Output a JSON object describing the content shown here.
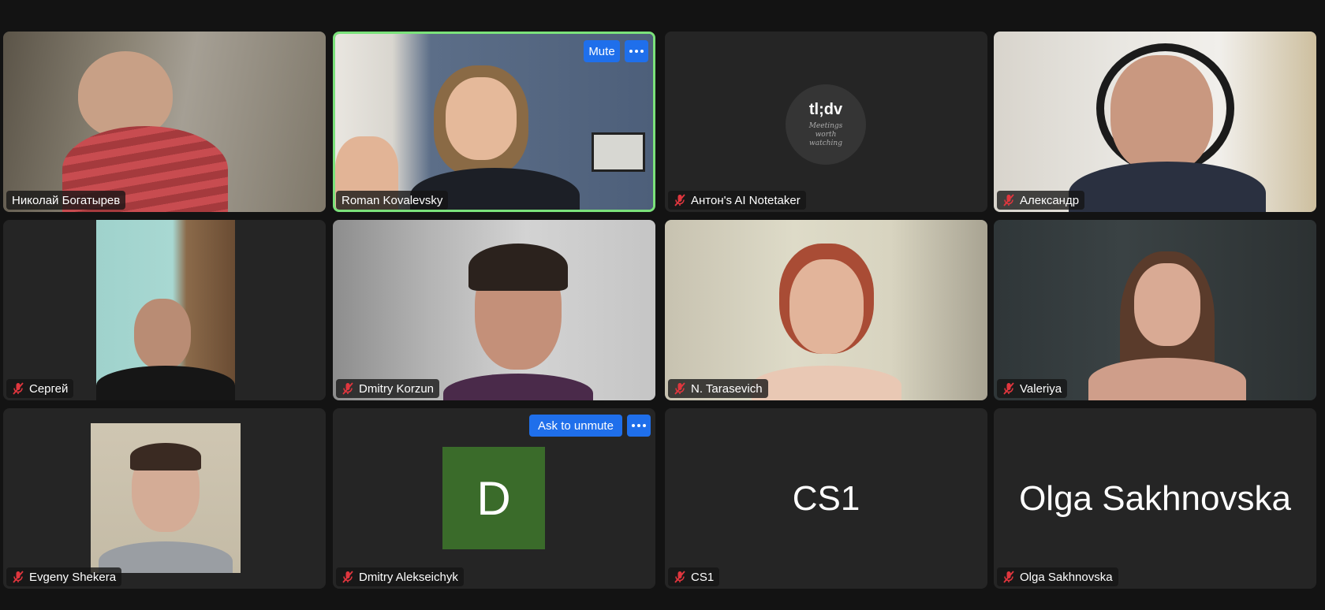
{
  "participants": [
    {
      "name": "Николай Богатырев",
      "muted": false
    },
    {
      "name": "Roman Kovalevsky",
      "muted": false,
      "speaking": true,
      "button": "Mute"
    },
    {
      "name": "Антон's AI Notetaker",
      "muted": true,
      "logo": "tl;dv",
      "tagline": "Meetings worth watching"
    },
    {
      "name": "Александр",
      "muted": true
    },
    {
      "name": "Сергей",
      "muted": true
    },
    {
      "name": "Dmitry Korzun",
      "muted": true
    },
    {
      "name": "N. Tarasevich",
      "muted": true
    },
    {
      "name": "Valeriya",
      "muted": true
    },
    {
      "name": "Evgeny Shekera",
      "muted": true
    },
    {
      "name": "Dmitry Alekseichyk",
      "muted": true,
      "avatar_letter": "D",
      "button": "Ask to unmute"
    },
    {
      "name": "CS1",
      "muted": true,
      "display_name": "CS1"
    },
    {
      "name": "Olga Sakhnovska",
      "muted": true,
      "display_name": "Olga Sakhnovska"
    }
  ],
  "colors": {
    "active_border": "#7be27b",
    "button": "#1f6feb",
    "muted_mic": "#e0363e",
    "avatar_bg": "#3a6b2a"
  }
}
